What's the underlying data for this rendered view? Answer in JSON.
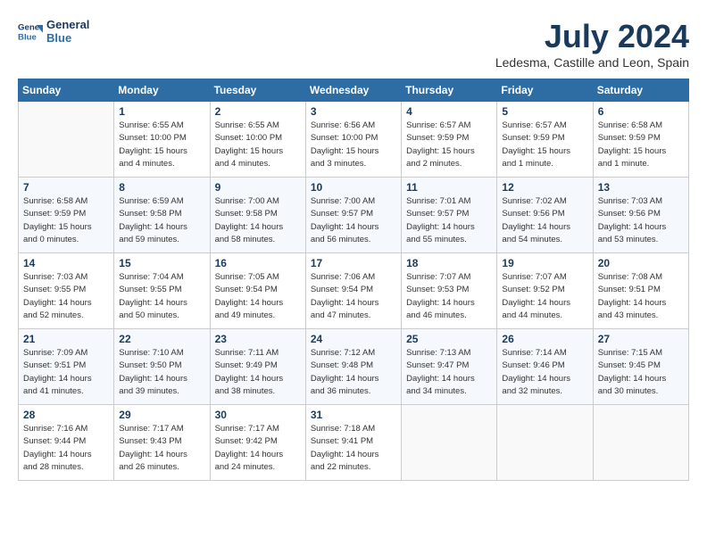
{
  "header": {
    "logo_line1": "General",
    "logo_line2": "Blue",
    "month": "July 2024",
    "location": "Ledesma, Castille and Leon, Spain"
  },
  "weekdays": [
    "Sunday",
    "Monday",
    "Tuesday",
    "Wednesday",
    "Thursday",
    "Friday",
    "Saturday"
  ],
  "weeks": [
    [
      {
        "day": "",
        "info": ""
      },
      {
        "day": "1",
        "info": "Sunrise: 6:55 AM\nSunset: 10:00 PM\nDaylight: 15 hours\nand 4 minutes."
      },
      {
        "day": "2",
        "info": "Sunrise: 6:55 AM\nSunset: 10:00 PM\nDaylight: 15 hours\nand 4 minutes."
      },
      {
        "day": "3",
        "info": "Sunrise: 6:56 AM\nSunset: 10:00 PM\nDaylight: 15 hours\nand 3 minutes."
      },
      {
        "day": "4",
        "info": "Sunrise: 6:57 AM\nSunset: 9:59 PM\nDaylight: 15 hours\nand 2 minutes."
      },
      {
        "day": "5",
        "info": "Sunrise: 6:57 AM\nSunset: 9:59 PM\nDaylight: 15 hours\nand 1 minute."
      },
      {
        "day": "6",
        "info": "Sunrise: 6:58 AM\nSunset: 9:59 PM\nDaylight: 15 hours\nand 1 minute."
      }
    ],
    [
      {
        "day": "7",
        "info": "Sunrise: 6:58 AM\nSunset: 9:59 PM\nDaylight: 15 hours\nand 0 minutes."
      },
      {
        "day": "8",
        "info": "Sunrise: 6:59 AM\nSunset: 9:58 PM\nDaylight: 14 hours\nand 59 minutes."
      },
      {
        "day": "9",
        "info": "Sunrise: 7:00 AM\nSunset: 9:58 PM\nDaylight: 14 hours\nand 58 minutes."
      },
      {
        "day": "10",
        "info": "Sunrise: 7:00 AM\nSunset: 9:57 PM\nDaylight: 14 hours\nand 56 minutes."
      },
      {
        "day": "11",
        "info": "Sunrise: 7:01 AM\nSunset: 9:57 PM\nDaylight: 14 hours\nand 55 minutes."
      },
      {
        "day": "12",
        "info": "Sunrise: 7:02 AM\nSunset: 9:56 PM\nDaylight: 14 hours\nand 54 minutes."
      },
      {
        "day": "13",
        "info": "Sunrise: 7:03 AM\nSunset: 9:56 PM\nDaylight: 14 hours\nand 53 minutes."
      }
    ],
    [
      {
        "day": "14",
        "info": "Sunrise: 7:03 AM\nSunset: 9:55 PM\nDaylight: 14 hours\nand 52 minutes."
      },
      {
        "day": "15",
        "info": "Sunrise: 7:04 AM\nSunset: 9:55 PM\nDaylight: 14 hours\nand 50 minutes."
      },
      {
        "day": "16",
        "info": "Sunrise: 7:05 AM\nSunset: 9:54 PM\nDaylight: 14 hours\nand 49 minutes."
      },
      {
        "day": "17",
        "info": "Sunrise: 7:06 AM\nSunset: 9:54 PM\nDaylight: 14 hours\nand 47 minutes."
      },
      {
        "day": "18",
        "info": "Sunrise: 7:07 AM\nSunset: 9:53 PM\nDaylight: 14 hours\nand 46 minutes."
      },
      {
        "day": "19",
        "info": "Sunrise: 7:07 AM\nSunset: 9:52 PM\nDaylight: 14 hours\nand 44 minutes."
      },
      {
        "day": "20",
        "info": "Sunrise: 7:08 AM\nSunset: 9:51 PM\nDaylight: 14 hours\nand 43 minutes."
      }
    ],
    [
      {
        "day": "21",
        "info": "Sunrise: 7:09 AM\nSunset: 9:51 PM\nDaylight: 14 hours\nand 41 minutes."
      },
      {
        "day": "22",
        "info": "Sunrise: 7:10 AM\nSunset: 9:50 PM\nDaylight: 14 hours\nand 39 minutes."
      },
      {
        "day": "23",
        "info": "Sunrise: 7:11 AM\nSunset: 9:49 PM\nDaylight: 14 hours\nand 38 minutes."
      },
      {
        "day": "24",
        "info": "Sunrise: 7:12 AM\nSunset: 9:48 PM\nDaylight: 14 hours\nand 36 minutes."
      },
      {
        "day": "25",
        "info": "Sunrise: 7:13 AM\nSunset: 9:47 PM\nDaylight: 14 hours\nand 34 minutes."
      },
      {
        "day": "26",
        "info": "Sunrise: 7:14 AM\nSunset: 9:46 PM\nDaylight: 14 hours\nand 32 minutes."
      },
      {
        "day": "27",
        "info": "Sunrise: 7:15 AM\nSunset: 9:45 PM\nDaylight: 14 hours\nand 30 minutes."
      }
    ],
    [
      {
        "day": "28",
        "info": "Sunrise: 7:16 AM\nSunset: 9:44 PM\nDaylight: 14 hours\nand 28 minutes."
      },
      {
        "day": "29",
        "info": "Sunrise: 7:17 AM\nSunset: 9:43 PM\nDaylight: 14 hours\nand 26 minutes."
      },
      {
        "day": "30",
        "info": "Sunrise: 7:17 AM\nSunset: 9:42 PM\nDaylight: 14 hours\nand 24 minutes."
      },
      {
        "day": "31",
        "info": "Sunrise: 7:18 AM\nSunset: 9:41 PM\nDaylight: 14 hours\nand 22 minutes."
      },
      {
        "day": "",
        "info": ""
      },
      {
        "day": "",
        "info": ""
      },
      {
        "day": "",
        "info": ""
      }
    ]
  ]
}
